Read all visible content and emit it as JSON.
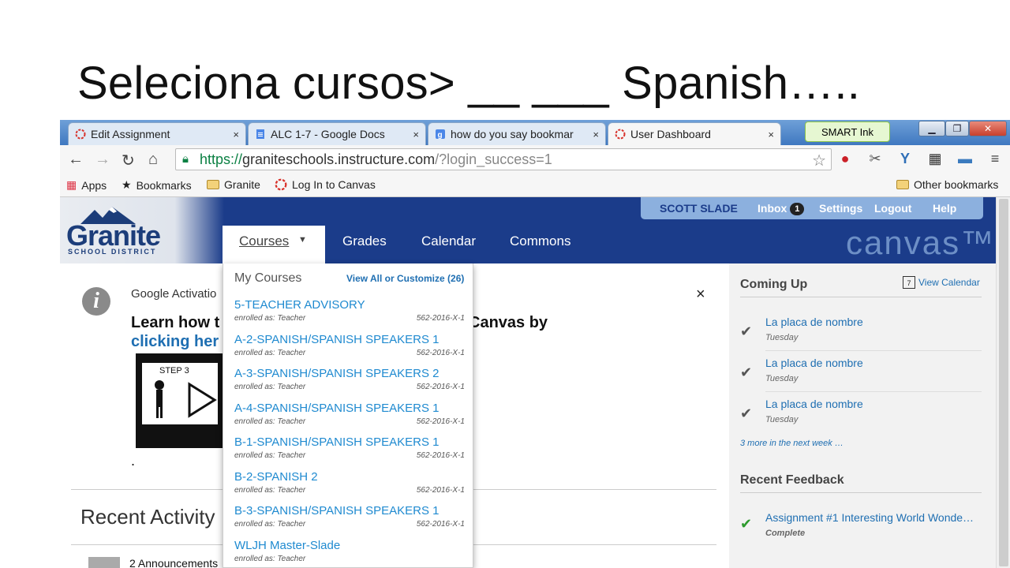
{
  "slide": {
    "title": "Seleciona cursos> __ ___ Spanish….."
  },
  "tabs": [
    {
      "label": "Edit Assignment",
      "icon": "canvas-logo-icon",
      "close": "×"
    },
    {
      "label": "ALC 1-7 - Google Docs",
      "icon": "google-docs-icon",
      "close": "×"
    },
    {
      "label": "how do you say bookmar",
      "icon": "google-search-icon",
      "close": "×"
    },
    {
      "label": "User Dashboard",
      "icon": "canvas-logo-icon",
      "close": "×"
    }
  ],
  "smart_ink": {
    "label": "SMART Ink"
  },
  "address": {
    "scheme": "https://",
    "host": "graniteschools.instructure.com",
    "path": "/?login_success=1"
  },
  "bookmarks": {
    "apps": "Apps",
    "bookmarks": "Bookmarks",
    "granite": "Granite",
    "login": "Log In to Canvas",
    "other": "Other bookmarks"
  },
  "header": {
    "logo_name": "Granite",
    "logo_sub": "SCHOOL DISTRICT",
    "user": "SCOTT SLADE",
    "inbox": "Inbox",
    "inbox_count": "1",
    "settings": "Settings",
    "logout": "Logout",
    "help": "Help",
    "nav": {
      "courses": "Courses",
      "grades": "Grades",
      "calendar": "Calendar",
      "commons": "Commons"
    },
    "brand": "canvas™"
  },
  "announcement": {
    "title": "Google Activatio",
    "close": "×",
    "text_start": "Learn how t",
    "text_end": "Canvas by",
    "link": "clicking her",
    "video_step": "STEP 3",
    "dot": "."
  },
  "recent_activity": {
    "heading": "Recent Activity",
    "announcements_count": "2 Announcements"
  },
  "dropdown": {
    "heading": "My Courses",
    "view_all": "View All or Customize (26)",
    "courses": [
      {
        "name": "5-TEACHER ADVISORY",
        "role": "enrolled as: Teacher",
        "code": "562-2016-X-1"
      },
      {
        "name": "A-2-SPANISH/SPANISH SPEAKERS 1",
        "role": "enrolled as: Teacher",
        "code": "562-2016-X-1"
      },
      {
        "name": "A-3-SPANISH/SPANISH SPEAKERS 2",
        "role": "enrolled as: Teacher",
        "code": "562-2016-X-1"
      },
      {
        "name": "A-4-SPANISH/SPANISH SPEAKERS 1",
        "role": "enrolled as: Teacher",
        "code": "562-2016-X-1"
      },
      {
        "name": "B-1-SPANISH/SPANISH SPEAKERS 1",
        "role": "enrolled as: Teacher",
        "code": "562-2016-X-1"
      },
      {
        "name": "B-2-SPANISH 2",
        "role": "enrolled as: Teacher",
        "code": "562-2016-X-1"
      },
      {
        "name": "B-3-SPANISH/SPANISH SPEAKERS 1",
        "role": "enrolled as: Teacher",
        "code": "562-2016-X-1"
      },
      {
        "name": "WLJH Master-Slade",
        "role": "enrolled as: Teacher",
        "code": ""
      }
    ]
  },
  "sidebar": {
    "coming_up": "Coming Up",
    "view_calendar": "View Calendar",
    "calendar_day": "7",
    "items": [
      {
        "title": "La placa de nombre",
        "when": "Tuesday"
      },
      {
        "title": "La placa de nombre",
        "when": "Tuesday"
      },
      {
        "title": "La placa de nombre",
        "when": "Tuesday"
      }
    ],
    "more": "3 more in the next week …",
    "recent_feedback": "Recent Feedback",
    "feedback": {
      "title": "Assignment #1 Interesting World Wonde…",
      "status": "Complete"
    }
  }
}
